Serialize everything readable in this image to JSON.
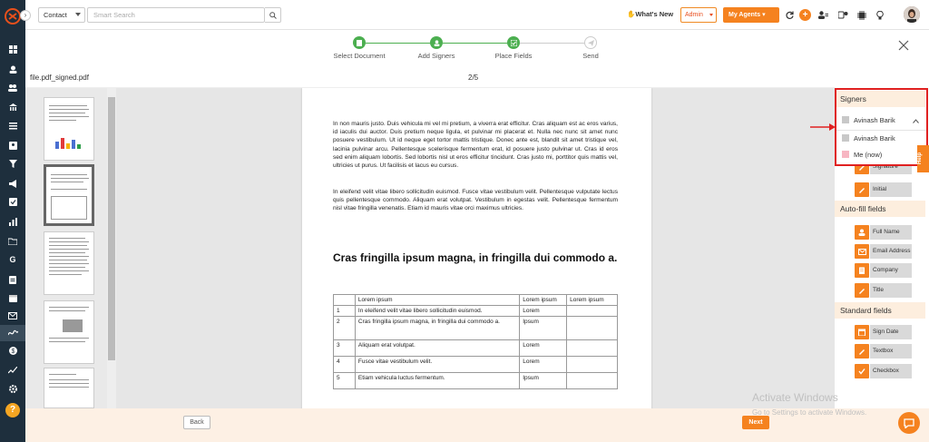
{
  "topbar": {
    "context_select": "Contact",
    "search_placeholder": "Smart Search",
    "whats_new": "What's New",
    "admin_select": "Admin",
    "my_agents": "My Agents"
  },
  "stepper": {
    "steps": [
      {
        "label": "Select Document",
        "state": "done"
      },
      {
        "label": "Add Signers",
        "state": "done"
      },
      {
        "label": "Place Fields",
        "state": "current"
      },
      {
        "label": "Send",
        "state": "pending"
      }
    ]
  },
  "document": {
    "filename": "file.pdf_signed.pdf",
    "page_indicator": "2/5",
    "paragraph1": "In non mauris justo. Duis vehicula mi vel mi pretium, a viverra erat efficitur. Cras aliquam est ac eros varius, id iaculis dui auctor. Duis pretium neque ligula, et pulvinar mi placerat et. Nulla nec nunc sit amet nunc posuere vestibulum. Ut id neque eget tortor mattis tristique. Donec ante est, blandit sit amet tristique vel, lacinia pulvinar arcu. Pellentesque scelerisque fermentum erat, id posuere justo pulvinar ut. Cras id eros sed enim aliquam lobortis. Sed lobortis nisl ut eros efficitur tincidunt. Cras justo mi, porttitor quis mattis vel, ultricies ut purus. Ut facilisis et lacus eu cursus.",
    "paragraph2": "In eleifend velit vitae libero sollicitudin euismod. Fusce vitae vestibulum velit. Pellentesque vulputate lectus quis pellentesque commodo. Aliquam erat volutpat. Vestibulum in egestas velit. Pellentesque fermentum nisl vitae fringilla venenatis. Etiam id mauris vitae orci maximus ultricies.",
    "heading": "Cras fringilla ipsum magna, in fringilla dui commodo a.",
    "table": {
      "header": [
        "",
        "Lorem ipsum",
        "Lorem ipsum",
        "Lorem ipsum"
      ],
      "rows": [
        [
          "1",
          "In eleifend velit vitae libero sollicitudin euismod.",
          "Lorem",
          ""
        ],
        [
          "2",
          "Cras fringilla ipsum magna, in fringilla dui commodo a.",
          "Ipsum",
          ""
        ],
        [
          "3",
          "Aliquam erat volutpat.",
          "Lorem",
          ""
        ],
        [
          "4",
          "Fusce vitae vestibulum velit.",
          "Lorem",
          ""
        ],
        [
          "5",
          "Etiam vehicula luctus fermentum.",
          "Ipsum",
          ""
        ]
      ]
    }
  },
  "signers": {
    "title": "Signers",
    "selected": "Avinash  Barik",
    "options": [
      {
        "label": "Avinash  Barik",
        "color": "#c8c8c8"
      },
      {
        "label": "Me (now)",
        "color": "#f7b6c2"
      }
    ]
  },
  "fields": {
    "signer_fields": [
      "Signature",
      "Initial"
    ],
    "autofill_title": "Auto-fill fields",
    "autofill_fields": [
      "Full Name",
      "Email Address",
      "Company",
      "Title"
    ],
    "standard_title": "Standard fields",
    "standard_fields": [
      "Sign Date",
      "Textbox",
      "Checkbox"
    ]
  },
  "help_tab": "Help",
  "footer": {
    "back": "Back",
    "next": "Next"
  },
  "watermark": {
    "line1": "Activate Windows",
    "line2": "Go to Settings to activate Windows."
  },
  "colors": {
    "accent": "#f5821f",
    "rail": "#1e2f3d",
    "step_done": "#4caf50",
    "highlight": "#e02020"
  }
}
